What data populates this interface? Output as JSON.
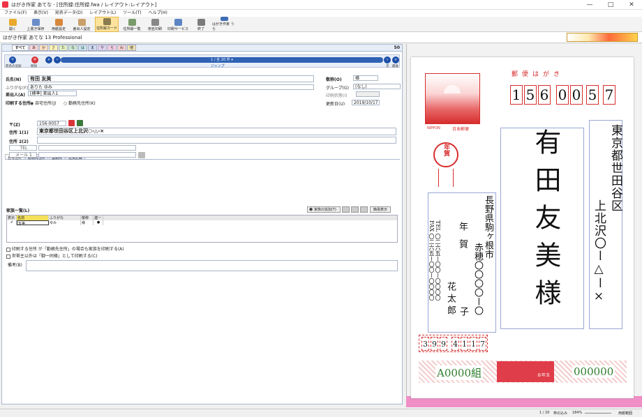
{
  "window": {
    "title": "はがき作家 あてな - [住所録:住所録.fwa / レイアウト:レイアウト]"
  },
  "menu": [
    "ファイル(F)",
    "表示(V)",
    "宛名データ(D)",
    "レイアウト(L)",
    "ツール(T)",
    "ヘルプ(H)"
  ],
  "toolbar": [
    {
      "label": "開く",
      "icon": "folder-icon"
    },
    {
      "label": "上書き保存",
      "icon": "save-icon"
    },
    {
      "label": "用紙設定",
      "icon": "paper-setup-icon"
    },
    {
      "label": "差出人設定",
      "icon": "sender-setup-icon"
    },
    {
      "label": "住所録カード",
      "icon": "address-card-icon"
    },
    {
      "label": "住所録一覧",
      "icon": "address-list-icon"
    },
    {
      "label": "宛名印刷",
      "icon": "print-icon"
    },
    {
      "label": "印刷サービス",
      "icon": "print-service-icon"
    },
    {
      "label": "終了",
      "icon": "exit-icon"
    },
    {
      "label": "はがき作家 うら",
      "icon": "back-side-icon"
    }
  ],
  "app": {
    "name": "はがき作家 あてな 13 Professional"
  },
  "kana_tabs": [
    "すべて",
    "あ",
    "か",
    "さ",
    "た",
    "な",
    "は",
    "ま",
    "や",
    "ら",
    "わ",
    "他"
  ],
  "kana_count": "50",
  "nav": {
    "add_label": "宛名の追加",
    "delete_label": "削除",
    "record": "1 / 全 20 件",
    "jump": "ジャンプ",
    "next_label": "次",
    "last_label": "最後"
  },
  "form": {
    "name_label": "氏名(N)",
    "name_value": "有田 友美",
    "furigana_label": "ふりがな(F)",
    "furigana_value": "ありた ゆみ",
    "sender_label": "差出人(A)",
    "sender_value": "[標準] 差出人1",
    "print_addr_label": "印刷する住所",
    "print_home": "自宅住所(J)",
    "print_work": "勤務先住所(K)",
    "title_label": "敬称(O)",
    "title_value": "様",
    "group_label": "グループ(G)",
    "group_value": "(なし)",
    "printed_label": "印刷状態(I)",
    "updated_label": "更新日(U)",
    "updated_value": "2019/10/17"
  },
  "subtabs": [
    "自宅住所",
    "勤務先住所",
    "連絡先",
    "送受記録"
  ],
  "address": {
    "zip_label": "〒(Z)",
    "zip_value": "156-0057",
    "addr1_label": "住所 1(1)",
    "addr1_value": "東京都世田谷区上北沢○-△-×",
    "addr2_label": "住所 2(2)",
    "tel_label": "TEL",
    "mail_label": "メール 1"
  },
  "family": {
    "title": "家族一覧(L)",
    "add_label": "家族の追加(T)",
    "simple_label": "簡易表示",
    "headers": [
      "表示",
      "名前",
      "ふりがな",
      "敬称",
      "連一"
    ],
    "rows": [
      {
        "check": "✔",
        "name": "友美",
        "furigana": "ゆみ",
        "honorific": "様",
        "link": "●"
      }
    ]
  },
  "options": {
    "opt1": "印刷する住所 が「勤務先住所」の場合も家族を印刷する(A)",
    "opt2": "世帯主以外は「御一同様」として印刷する(C)"
  },
  "remarks_label": "備考(B)",
  "status": {
    "page": "1 / 20",
    "fit": "枠の込み",
    "zoom": "184%",
    "view": "用紙範囲"
  },
  "postcard": {
    "header": "郵便はがき",
    "recipient_zip": [
      "1",
      "5",
      "6",
      "0",
      "0",
      "5",
      "7"
    ],
    "recipient_addr1": "東京都世田谷区",
    "recipient_addr2": "上北沢〇ー△ー×",
    "recipient_name": "有田友美様",
    "sender_addr": "長野県駒ヶ根市",
    "sender_addr2": "赤穂〇〇〇〇ー〇",
    "sender_name1": "年賀",
    "sender_name2": "花太郎",
    "sender_name3": "子",
    "tel": "TEL 〇二六五ー〇〇ー〇〇〇〇",
    "fax": "FAX 〇二六五ー〇〇ー〇〇〇〇",
    "sender_zip": [
      "3",
      "9",
      "9",
      "4",
      "1",
      "1",
      "7"
    ],
    "stamp_text": "日本郵便",
    "stamp_brand": "NIPPON",
    "newyear_stamp": "年賀",
    "lottery_group": "A0000組",
    "lottery_number": "000000",
    "lottery_label": "お年玉"
  },
  "colors": {
    "accent": "#2e62b4",
    "red": "#d62d2d",
    "pink": "#f08ec6",
    "green": "#2d7d2d"
  }
}
